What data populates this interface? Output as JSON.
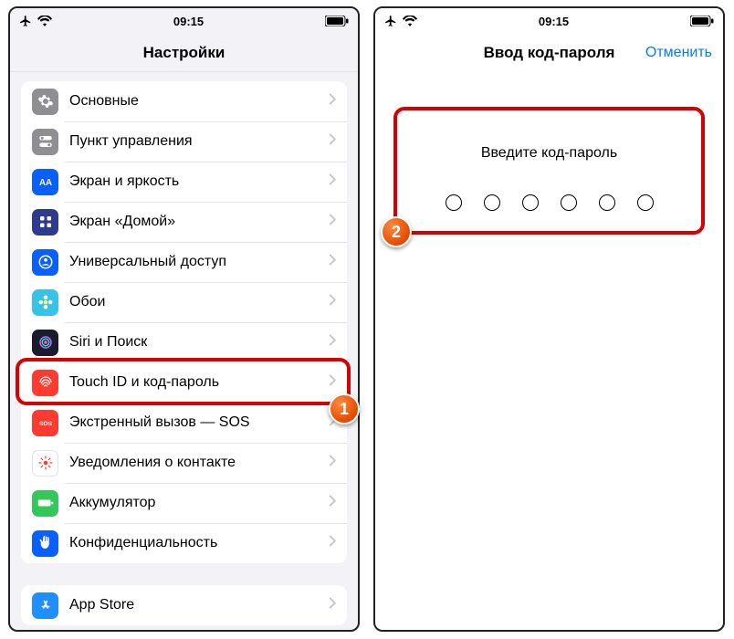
{
  "status": {
    "time": "09:15"
  },
  "left": {
    "title": "Настройки",
    "group1": [
      {
        "label": "Основные",
        "name": "general",
        "bg": "#8e8e93",
        "glyph": "gear"
      },
      {
        "label": "Пункт управления",
        "name": "control-center",
        "bg": "#8e8e93",
        "glyph": "toggles"
      },
      {
        "label": "Экран и яркость",
        "name": "display",
        "bg": "#0a60ff",
        "glyph": "aa"
      },
      {
        "label": "Экран «Домой»",
        "name": "home-screen",
        "bg": "#2e3a8c",
        "glyph": "grid"
      },
      {
        "label": "Универсальный доступ",
        "name": "accessibility",
        "bg": "#0a60ff",
        "glyph": "person"
      },
      {
        "label": "Обои",
        "name": "wallpaper",
        "bg": "#37c3e6",
        "glyph": "flower"
      },
      {
        "label": "Siri и Поиск",
        "name": "siri",
        "bg": "#1b1b2e",
        "glyph": "siri"
      },
      {
        "label": "Touch ID и код-пароль",
        "name": "touchid",
        "bg": "#ff3b30",
        "glyph": "finger"
      },
      {
        "label": "Экстренный вызов — SOS",
        "name": "sos",
        "bg": "#ff3b30",
        "glyph": "sos"
      },
      {
        "label": "Уведомления о контакте",
        "name": "exposure",
        "bg": "#ffffff",
        "glyph": "exposure"
      },
      {
        "label": "Аккумулятор",
        "name": "battery",
        "bg": "#34c759",
        "glyph": "battery"
      },
      {
        "label": "Конфиденциальность",
        "name": "privacy",
        "bg": "#0a60ff",
        "glyph": "hand"
      }
    ],
    "group2": [
      {
        "label": "App Store",
        "name": "appstore",
        "bg": "#1f8fff",
        "glyph": "appstore"
      }
    ],
    "highlightIndex": 7,
    "calloutNum": "1"
  },
  "right": {
    "title": "Ввод код-пароля",
    "cancel": "Отменить",
    "prompt": "Введите код-пароль",
    "dotCount": 6,
    "calloutNum": "2"
  }
}
